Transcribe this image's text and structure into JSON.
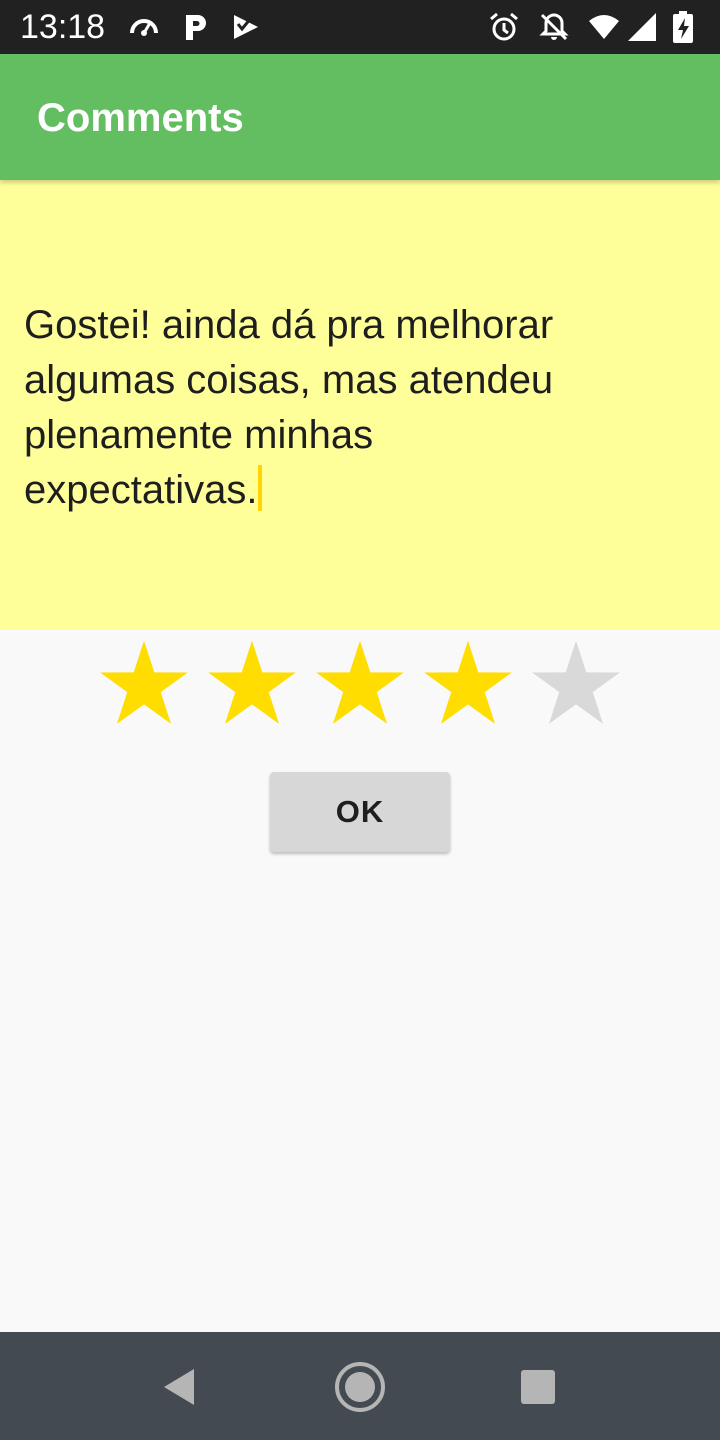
{
  "status_bar": {
    "time": "13:18",
    "left_icons": [
      "speedometer-icon",
      "parking-p-icon",
      "play-store-check-icon"
    ],
    "right_icons": [
      "alarm-icon",
      "notifications-off-icon",
      "wifi-icon",
      "signal-icon",
      "battery-charging-icon"
    ]
  },
  "app_bar": {
    "title": "Comments",
    "color": "#62be61"
  },
  "comment": {
    "lines": [
      "Gostei! ainda dá pra melhorar",
      "algumas coisas, mas atendeu",
      "plenamente minhas",
      "expectativas."
    ],
    "background": "#ffff9a",
    "caret_color": "#ffd400"
  },
  "rating": {
    "value": 4,
    "max": 5,
    "filled_color": "#ffdd00",
    "empty_color": "#d9d9d9"
  },
  "ok_button": {
    "label": "OK"
  },
  "nav_bar": {
    "buttons": [
      "back-icon",
      "home-icon",
      "recents-icon"
    ]
  }
}
